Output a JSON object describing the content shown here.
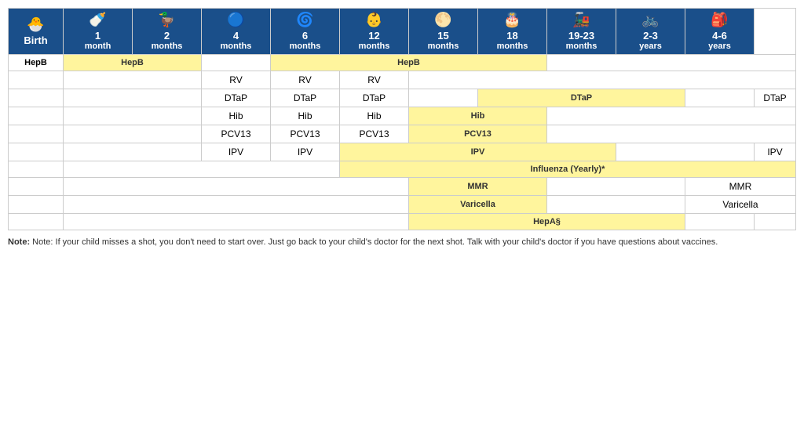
{
  "table": {
    "headers": [
      {
        "icon": "🐣",
        "line1": "Birth",
        "line2": ""
      },
      {
        "icon": "🍼",
        "line1": "1",
        "line2": "month"
      },
      {
        "icon": "🦆",
        "line1": "2",
        "line2": "months"
      },
      {
        "icon": "🔵",
        "line1": "4",
        "line2": "months"
      },
      {
        "icon": "🌀",
        "line1": "6",
        "line2": "months"
      },
      {
        "icon": "👶",
        "line1": "12",
        "line2": "months"
      },
      {
        "icon": "🌕",
        "line1": "15",
        "line2": "months"
      },
      {
        "icon": "🎂",
        "line1": "18",
        "line2": "months"
      },
      {
        "icon": "🚂",
        "line1": "19-23",
        "line2": "months"
      },
      {
        "icon": "🚲",
        "line1": "2-3",
        "line2": "years"
      },
      {
        "icon": "🎒",
        "line1": "4-6",
        "line2": "years"
      }
    ],
    "rows": [
      {
        "label": "HepB",
        "cells": [
          {
            "type": "yellow",
            "colspan": 2,
            "text": "HepB"
          },
          {
            "type": "empty",
            "colspan": 1,
            "text": ""
          },
          {
            "type": "yellow",
            "colspan": 4,
            "text": "HepB"
          },
          {
            "type": "empty",
            "colspan": 4,
            "text": ""
          }
        ]
      },
      {
        "label": "",
        "cells": [
          {
            "type": "empty",
            "colspan": 2,
            "text": ""
          },
          {
            "type": "text",
            "colspan": 1,
            "text": "RV"
          },
          {
            "type": "text",
            "colspan": 1,
            "text": "RV"
          },
          {
            "type": "text",
            "colspan": 1,
            "text": "RV"
          },
          {
            "type": "empty",
            "colspan": 6,
            "text": ""
          }
        ]
      },
      {
        "label": "",
        "cells": [
          {
            "type": "empty",
            "colspan": 2,
            "text": ""
          },
          {
            "type": "text",
            "colspan": 1,
            "text": "DTaP"
          },
          {
            "type": "text",
            "colspan": 1,
            "text": "DTaP"
          },
          {
            "type": "text",
            "colspan": 1,
            "text": "DTaP"
          },
          {
            "type": "empty",
            "colspan": 1,
            "text": ""
          },
          {
            "type": "yellow",
            "colspan": 3,
            "text": "DTaP"
          },
          {
            "type": "empty",
            "colspan": 1,
            "text": ""
          },
          {
            "type": "text",
            "colspan": 1,
            "text": "DTaP"
          }
        ]
      },
      {
        "label": "",
        "cells": [
          {
            "type": "empty",
            "colspan": 2,
            "text": ""
          },
          {
            "type": "text",
            "colspan": 1,
            "text": "Hib"
          },
          {
            "type": "text",
            "colspan": 1,
            "text": "Hib"
          },
          {
            "type": "text",
            "colspan": 1,
            "text": "Hib"
          },
          {
            "type": "yellow",
            "colspan": 2,
            "text": "Hib"
          },
          {
            "type": "empty",
            "colspan": 4,
            "text": ""
          }
        ]
      },
      {
        "label": "",
        "cells": [
          {
            "type": "empty",
            "colspan": 2,
            "text": ""
          },
          {
            "type": "text",
            "colspan": 1,
            "text": "PCV13"
          },
          {
            "type": "text",
            "colspan": 1,
            "text": "PCV13"
          },
          {
            "type": "text",
            "colspan": 1,
            "text": "PCV13"
          },
          {
            "type": "yellow",
            "colspan": 2,
            "text": "PCV13"
          },
          {
            "type": "empty",
            "colspan": 4,
            "text": ""
          }
        ]
      },
      {
        "label": "",
        "cells": [
          {
            "type": "empty",
            "colspan": 2,
            "text": ""
          },
          {
            "type": "text",
            "colspan": 1,
            "text": "IPV"
          },
          {
            "type": "text",
            "colspan": 1,
            "text": "IPV"
          },
          {
            "type": "yellow",
            "colspan": 4,
            "text": "IPV"
          },
          {
            "type": "empty",
            "colspan": 2,
            "text": ""
          },
          {
            "type": "text",
            "colspan": 1,
            "text": "IPV"
          }
        ]
      },
      {
        "label": "",
        "cells": [
          {
            "type": "empty",
            "colspan": 4,
            "text": ""
          },
          {
            "type": "yellow",
            "colspan": 7,
            "text": "Influenza (Yearly)*"
          }
        ]
      },
      {
        "label": "",
        "cells": [
          {
            "type": "empty",
            "colspan": 5,
            "text": ""
          },
          {
            "type": "yellow",
            "colspan": 2,
            "text": "MMR"
          },
          {
            "type": "empty",
            "colspan": 2,
            "text": ""
          },
          {
            "type": "text",
            "colspan": 2,
            "text": "MMR"
          }
        ]
      },
      {
        "label": "",
        "cells": [
          {
            "type": "empty",
            "colspan": 5,
            "text": ""
          },
          {
            "type": "yellow",
            "colspan": 2,
            "text": "Varicella"
          },
          {
            "type": "empty",
            "colspan": 2,
            "text": ""
          },
          {
            "type": "text",
            "colspan": 2,
            "text": "Varicella"
          }
        ]
      },
      {
        "label": "",
        "cells": [
          {
            "type": "empty",
            "colspan": 5,
            "text": ""
          },
          {
            "type": "yellow",
            "colspan": 4,
            "text": "HepA§"
          },
          {
            "type": "empty",
            "colspan": 1,
            "text": ""
          },
          {
            "type": "empty",
            "colspan": 1,
            "text": ""
          }
        ]
      }
    ],
    "note": "Note: If your child misses a shot, you don't need to start over. Just go back to your child's doctor for the next shot. Talk with your child's doctor if you have questions about vaccines."
  }
}
